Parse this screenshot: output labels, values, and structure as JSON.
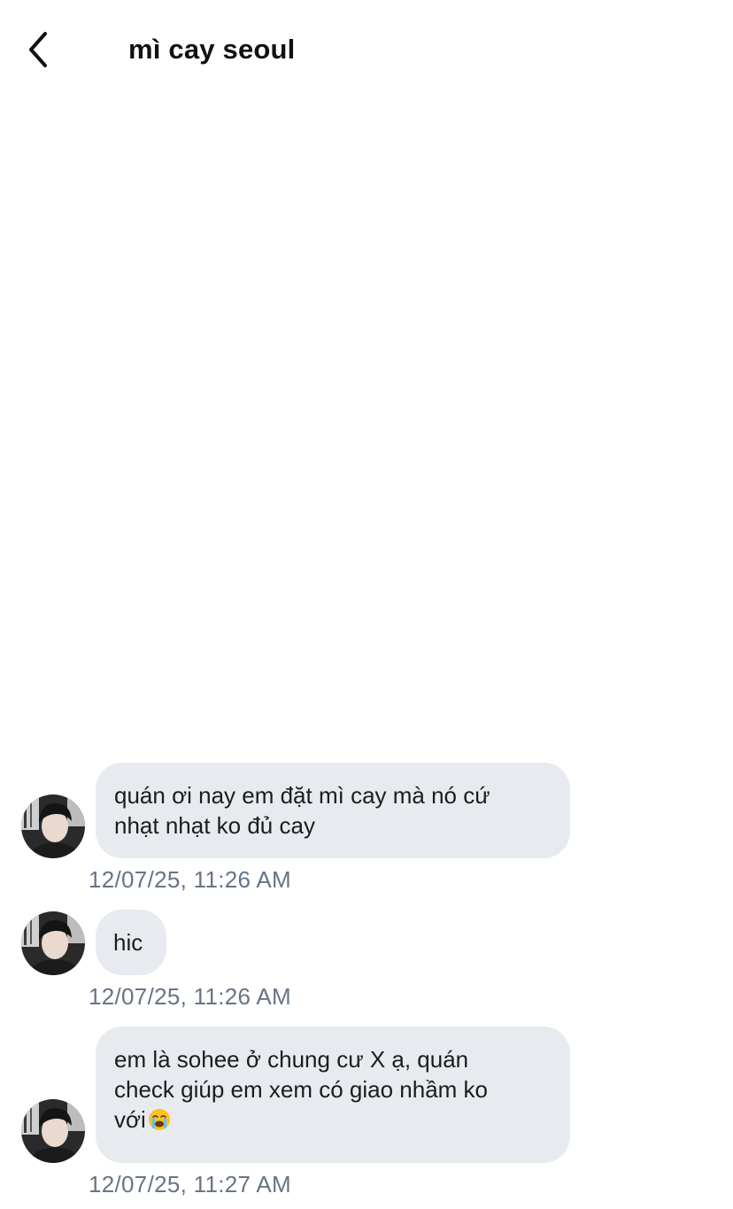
{
  "header": {
    "back_icon": "chevron-left-icon",
    "title": "mì cay seoul"
  },
  "colors": {
    "bubble_background": "#e7ebef",
    "timestamp_text": "#677485",
    "title_text": "#111111"
  },
  "messages": [
    {
      "text": "quán ơi nay em đặt mì cay mà nó cứ\nnhạt nhạt ko đủ cay",
      "timestamp": "12/07/25, 11:26 AM"
    },
    {
      "text": "hic",
      "timestamp": "12/07/25, 11:26 AM"
    },
    {
      "text": "em là sohee ở chung cư X ạ, quán\ncheck giúp em xem có giao nhầm ko\nvới",
      "emoji": "loudly-crying-face-icon",
      "timestamp": "12/07/25, 11:27 AM"
    }
  ]
}
